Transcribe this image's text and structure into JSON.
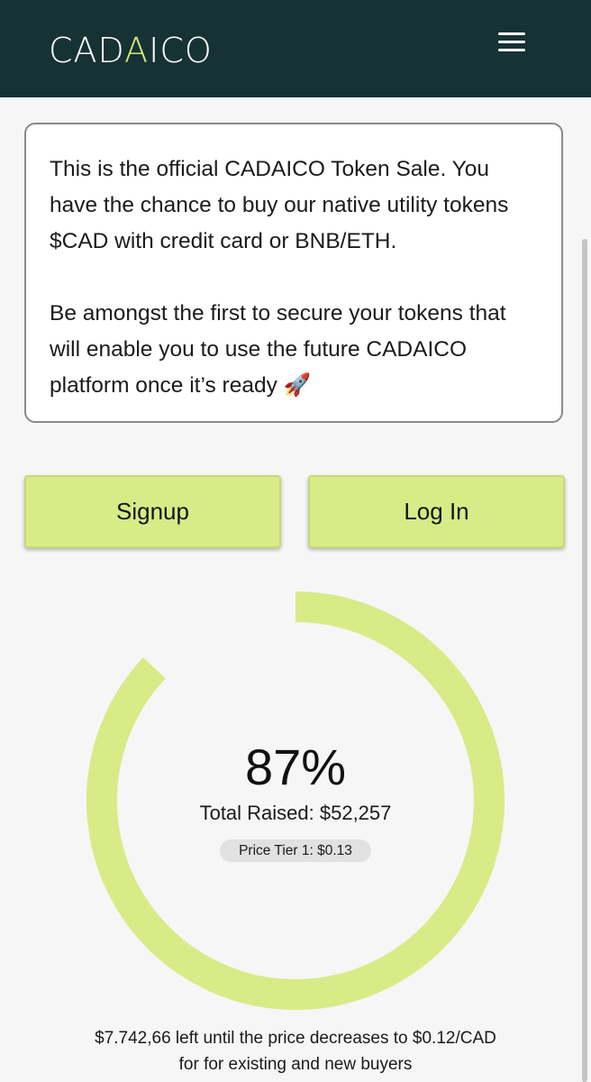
{
  "header": {
    "logo_text_1": "CAD",
    "logo_text_accent": "A",
    "logo_text_2": "ICO",
    "menu_icon": "hamburger-menu-icon",
    "background_color": "#173234",
    "accent_color": "#d6e97d"
  },
  "info": {
    "paragraph_1": "This is the official CADAICO Token Sale. You have the chance to buy our native utility tokens $CAD with credit card or BNB/ETH.",
    "paragraph_2": "Be amongst the first to secure your tokens that will enable you to use the future CADAICO platform once it’s ready 🚀"
  },
  "buttons": {
    "signup_label": "Signup",
    "login_label": "Log In",
    "color": "#d8eb87"
  },
  "progress": {
    "percent_label": "87%",
    "percent_value": 87,
    "ring_color": "#d8eb87",
    "total_raised": "Total Raised: $52,257",
    "price_tier": "Price Tier 1: $0.13"
  },
  "footer": {
    "line_1": "$7.742,66 left until the price decreases to $0.12/CAD",
    "line_2": "for for existing and new buyers"
  }
}
